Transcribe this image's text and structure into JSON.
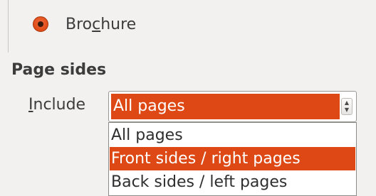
{
  "booklet": {
    "option_label_before": "Bro",
    "option_label_mnemonic": "c",
    "option_label_after": "hure",
    "option_selected": true
  },
  "page_sides": {
    "title": "Page sides",
    "include_label_mnemonic": "I",
    "include_label_rest": "nclude",
    "include_value": "All pages",
    "options": [
      "All pages",
      "Front sides / right pages",
      "Back sides / left pages"
    ],
    "highlighted_option": "Front sides / right pages"
  },
  "colors": {
    "accent": "#dd4814",
    "background": "#f2f1f0"
  },
  "icons": {
    "radio": "radio-selected-icon",
    "spinner": "combo-up-down-icon"
  }
}
